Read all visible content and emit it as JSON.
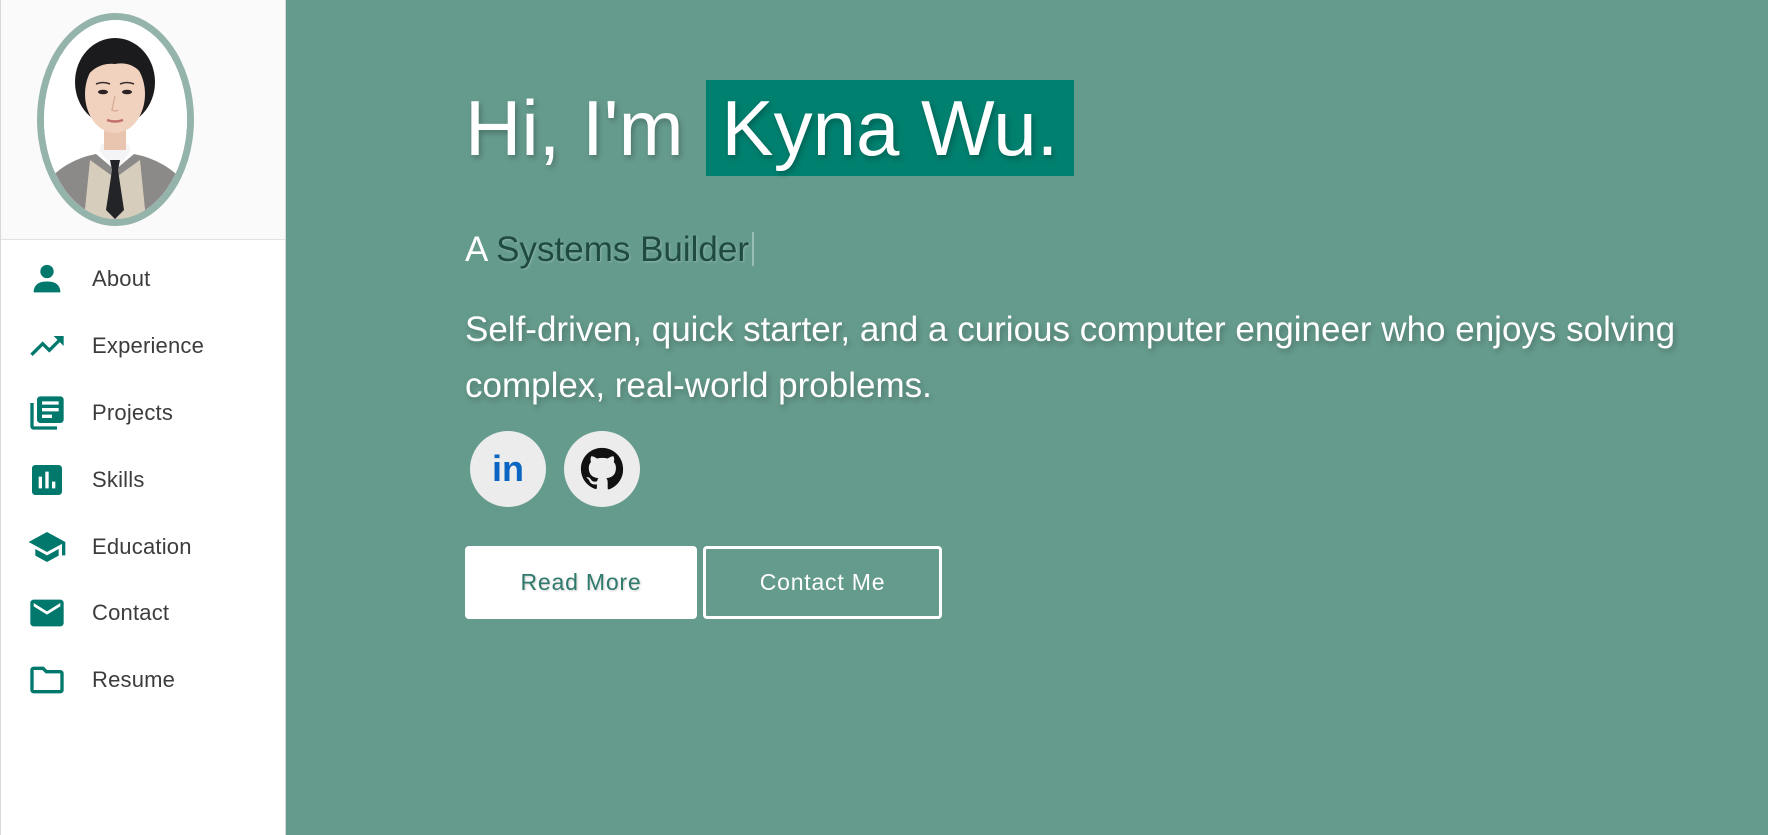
{
  "sidebar": {
    "items": [
      {
        "label": "About",
        "icon": "person-icon"
      },
      {
        "label": "Experience",
        "icon": "trending-up-icon"
      },
      {
        "label": "Projects",
        "icon": "library-books-icon"
      },
      {
        "label": "Skills",
        "icon": "bar-chart-icon"
      },
      {
        "label": "Education",
        "icon": "graduation-cap-icon"
      },
      {
        "label": "Contact",
        "icon": "mail-icon"
      },
      {
        "label": "Resume",
        "icon": "folder-icon"
      }
    ]
  },
  "hero": {
    "greeting": "Hi, I'm",
    "name": "Kyna Wu.",
    "subtitle_prefix": "A",
    "subtitle_role": "Systems Builder",
    "description": "Self-driven, quick starter, and a curious computer engineer who enjoys solving complex, real-world problems.",
    "socials": [
      {
        "label": "in",
        "icon": "linkedin-icon"
      },
      {
        "icon": "github-icon"
      }
    ],
    "read_more_label": "Read More",
    "contact_label": "Contact Me"
  },
  "colors": {
    "accent": "#00786c",
    "background": "#659b8d",
    "name_highlight": "#00806f",
    "linkedin_blue": "#0a66c2"
  }
}
